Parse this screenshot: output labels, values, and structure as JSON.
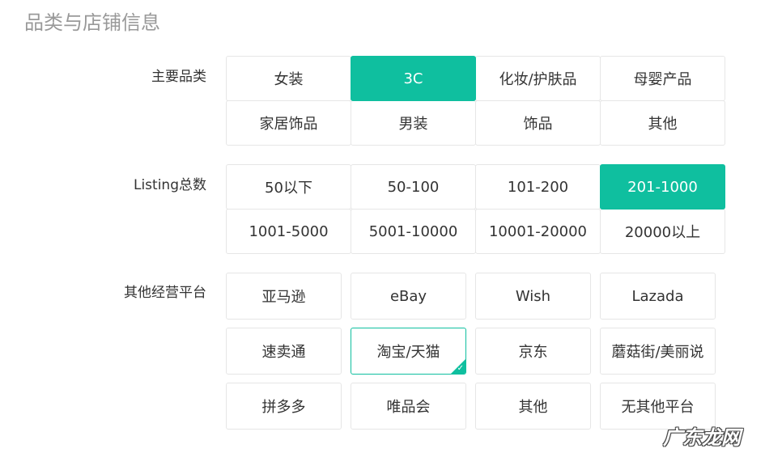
{
  "section_title": "品类与店铺信息",
  "accent_color": "#0fbf9f",
  "main_category": {
    "label": "主要品类",
    "options": [
      "女装",
      "3C",
      "化妆/护肤品",
      "母婴产品",
      "家居饰品",
      "男装",
      "饰品",
      "其他"
    ],
    "selected": "3C"
  },
  "listing_total": {
    "label": "Listing总数",
    "options": [
      "50以下",
      "50-100",
      "101-200",
      "201-1000",
      "1001-5000",
      "5001-10000",
      "10001-20000",
      "20000以上"
    ],
    "selected": "201-1000"
  },
  "other_platforms": {
    "label": "其他经营平台",
    "options": [
      "亚马逊",
      "eBay",
      "Wish",
      "Lazada",
      "速卖通",
      "淘宝/天猫",
      "京东",
      "蘑菇街/美丽说",
      "拼多多",
      "唯品会",
      "其他",
      "无其他平台"
    ],
    "selected": [
      "淘宝/天猫"
    ],
    "check_icon": "check-icon"
  },
  "watermark": "广东龙网"
}
